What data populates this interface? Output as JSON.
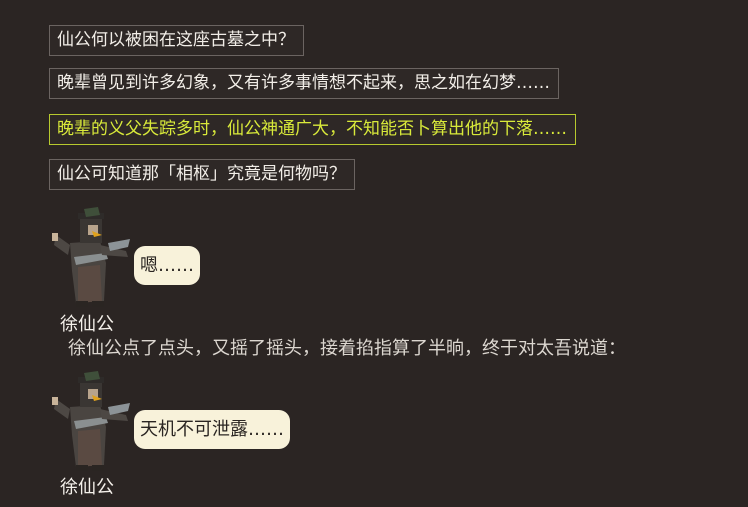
{
  "choices": [
    {
      "label": "仙公何以被困在这座古墓之中？"
    },
    {
      "label": "晚辈曾见到许多幻象，又有许多事情想不起来，思之如在幻梦……"
    },
    {
      "label": "晚辈的义父失踪多时，仙公神通广大，不知能否卜算出他的下落……"
    },
    {
      "label": "仙公可知道那「相枢」究竟是何物吗？"
    }
  ],
  "selected_choice": 2,
  "dialogue": [
    {
      "speaker": "徐仙公",
      "text": "嗯……"
    },
    {
      "speaker": "徐仙公",
      "text": "天机不可泄露……"
    }
  ],
  "narration": "徐仙公点了点头，又摇了摇头，接着掐指算了半晌，终于对太吾说道：",
  "colors": {
    "background": "#2b2523",
    "choice_border": "#6b6461",
    "choice_selected": "#d9ea3a",
    "bubble": "#f8f2da"
  }
}
